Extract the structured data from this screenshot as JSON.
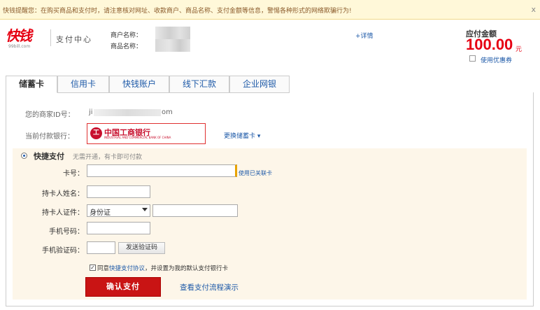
{
  "warning": {
    "text": "快钱提醒您：在购买商品和支付时，请注意核对网址、收款商户、商品名称、支付金额等信息，警惕各种形式的网络欺骗行为!",
    "close": "x"
  },
  "header": {
    "logo_text": "快钱",
    "logo_sub": "99bill.com",
    "title": "支付中心",
    "merchant_label": "商户名称：",
    "product_label": "商品名称：",
    "detail_link": "+详情",
    "amount_label": "应付金额",
    "amount_value": "100.00",
    "amount_unit": "元",
    "coupon_label": "使用优惠券"
  },
  "tabs": [
    {
      "label": "储蓄卡",
      "active": true
    },
    {
      "label": "信用卡",
      "active": false
    },
    {
      "label": "快钱账户",
      "active": false
    },
    {
      "label": "线下汇款",
      "active": false
    },
    {
      "label": "企业网银",
      "active": false
    }
  ],
  "merchant": {
    "id_label": "您的商家ID号：",
    "id_prefix": "ji",
    "id_suffix": "om"
  },
  "bank": {
    "label": "当前付款银行：",
    "logo_glyph": "工",
    "name": "中国工商银行",
    "name_en": "INDUSTRIAL AND COMMERCIAL BANK OF CHINA",
    "change_link": "更换储蓄卡 ▾"
  },
  "quick_pay": {
    "title": "快捷支付",
    "desc": "无需开通，有卡即可付款",
    "card_label": "卡号：",
    "linked_card_link": "使用已关联卡",
    "holder_name_label": "持卡人姓名：",
    "id_label": "持卡人证件：",
    "id_type": "身份证",
    "phone_label": "手机号码：",
    "sms_label": "手机验证码：",
    "sms_button": "发送验证码",
    "agree_prefix": "同意",
    "agree_link": "快捷支付协议",
    "agree_suffix": "，并设置为我的默认支付银行卡",
    "checkmark": "✓",
    "confirm_button": "确认支付",
    "demo_link": "查看支付流程演示"
  },
  "colors": {
    "brand_red": "#e60012",
    "link_blue": "#1e5aa8",
    "confirm_red": "#c91414"
  }
}
